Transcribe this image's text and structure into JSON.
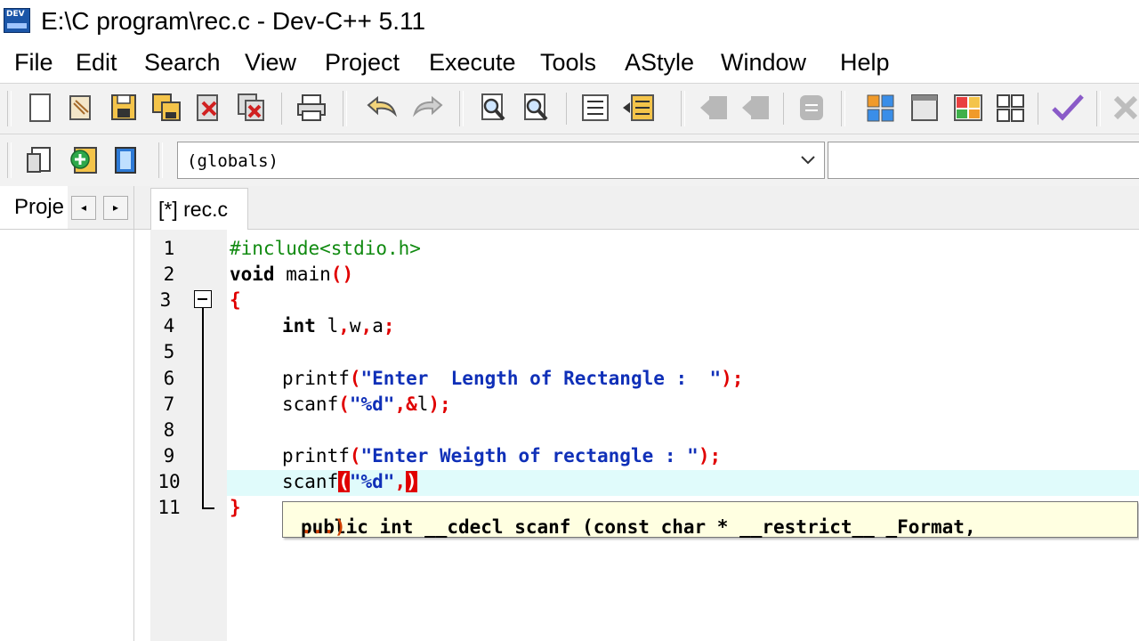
{
  "title_bar": {
    "title": "E:\\C program\\rec.c - Dev-C++ 5.11",
    "icon": "devcpp-app-icon",
    "icon_text": "DEV"
  },
  "menu": [
    "File",
    "Edit",
    "Search",
    "View",
    "Project",
    "Execute",
    "Tools",
    "AStyle",
    "Window",
    "Help"
  ],
  "toolbar_main": [
    "new-file-icon",
    "open-file-icon",
    "save-icon",
    "save-all-icon",
    "close-icon",
    "close-all-icon",
    "print-icon",
    "undo-icon",
    "redo-icon",
    "find-icon",
    "replace-icon",
    "indent-icon",
    "unindent-icon",
    "bookmark-icon",
    "goto-icon",
    "toggle-comment-icon",
    "layout-icon",
    "window-icon",
    "tile-icon",
    "grid-icon",
    "check-icon",
    "delete-icon"
  ],
  "toolbar_project": [
    "new-project-icon",
    "add-file-icon",
    "remove-icon"
  ],
  "scope_combo": {
    "value": "(globals)"
  },
  "left_panel": {
    "tab_label": "Proje",
    "prev": "◂",
    "next": "▸"
  },
  "editor": {
    "tab_label": "[*] rec.c",
    "line_numbers": [
      "1",
      "2",
      "3",
      "4",
      "5",
      "6",
      "7",
      "8",
      "9",
      "10",
      "11"
    ],
    "lines": {
      "l1": "#include<stdio.h>",
      "l2_kw": "void",
      "l2_rest": " main",
      "l2_paren": "()",
      "l3": "{",
      "l4_kw": "int",
      "l4_a": " l",
      "l4_c1": ",",
      "l4_b": "w",
      "l4_c2": ",",
      "l4_c": "a",
      "l4_semi": ";",
      "l6_fn": "printf",
      "l6_p1": "(",
      "l6_str": "\"Enter  Length of Rectangle :  \"",
      "l6_p2": ");",
      "l7_fn": "scanf",
      "l7_p1": "(",
      "l7_str": "\"%d\"",
      "l7_c": ",&",
      "l7_v": "l",
      "l7_p2": ");",
      "l9_fn": "printf",
      "l9_p1": "(",
      "l9_str": "\"Enter Weigth of rectangle : \"",
      "l9_p2": ");",
      "l10_fn": "scanf",
      "l10_p1": "(",
      "l10_str": "\"%d\"",
      "l10_c": ",",
      "l10_p2": ")",
      "l11": "}"
    },
    "tooltip": {
      "text": "public int __cdecl scanf (const char * __restrict__ _Format, ",
      "ellipsis": "...)"
    }
  }
}
